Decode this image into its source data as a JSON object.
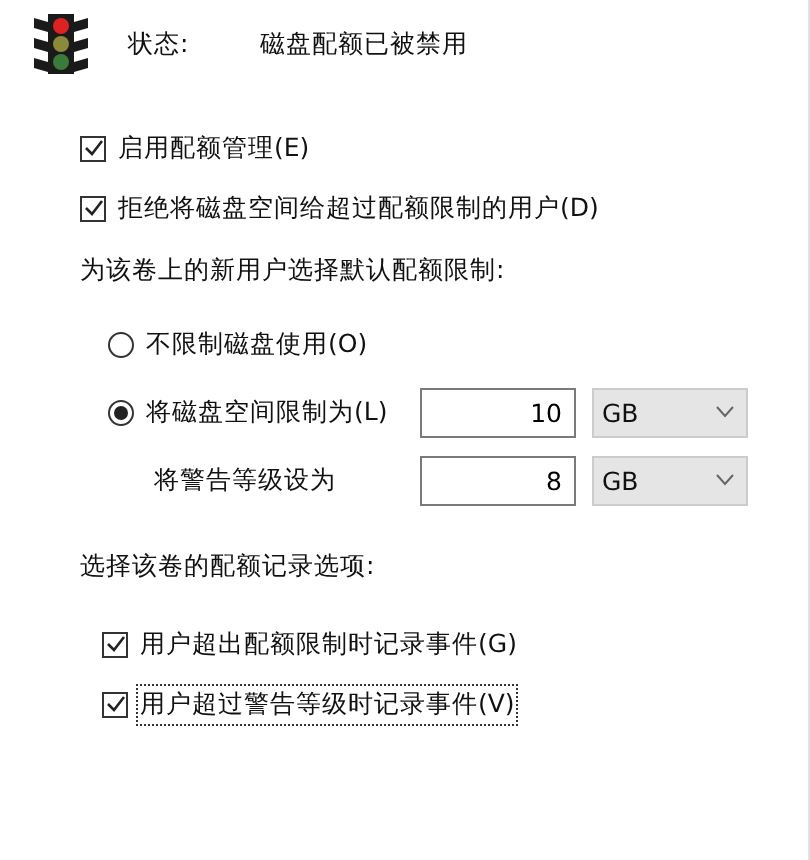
{
  "status": {
    "label": "状态:",
    "value": "磁盘配额已被禁用"
  },
  "options": [
    {
      "label": "启用配额管理(E)",
      "checked": true
    },
    {
      "label": "拒绝将磁盘空间给超过配额限制的用户(D)",
      "checked": true
    }
  ],
  "default_limit": {
    "heading": "为该卷上的新用户选择默认配额限制:",
    "radios": [
      {
        "label": "不限制磁盘使用(O)",
        "selected": false
      },
      {
        "label": "将磁盘空间限制为(L)",
        "selected": true,
        "value": "10",
        "unit": "GB"
      }
    ],
    "warning": {
      "label": "将警告等级设为",
      "value": "8",
      "unit": "GB"
    }
  },
  "logging": {
    "heading": "选择该卷的配额记录选项:",
    "options": [
      {
        "label": "用户超出配额限制时记录事件(G)",
        "checked": true,
        "focused": false
      },
      {
        "label": "用户超过警告等级时记录事件(V)",
        "checked": true,
        "focused": true
      }
    ]
  }
}
